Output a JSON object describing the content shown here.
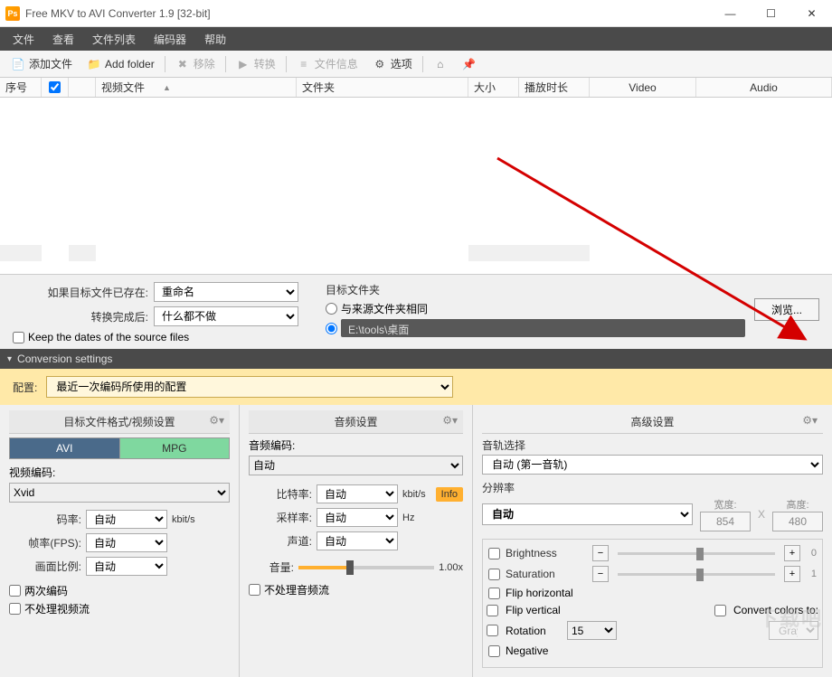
{
  "window": {
    "title": "Free MKV to AVI Converter 1.9  [32-bit]"
  },
  "menu": {
    "file": "文件",
    "view": "查看",
    "filelist": "文件列表",
    "encoder": "编码器",
    "help": "帮助"
  },
  "toolbar": {
    "add_file": "添加文件",
    "add_folder": "Add folder",
    "remove": "移除",
    "convert": "转换",
    "file_info": "文件信息",
    "options": "选项"
  },
  "grid": {
    "seq": "序号",
    "video_file": "视频文件",
    "folder": "文件夹",
    "size": "大小",
    "duration": "播放时长",
    "video": "Video",
    "audio": "Audio"
  },
  "existing": {
    "when_exists_label": "如果目标文件已存在:",
    "when_exists_value": "重命名",
    "after_conv_label": "转换完成后:",
    "after_conv_value": "什么都不做",
    "keep_dates": "Keep the dates of the source files"
  },
  "dest": {
    "label": "目标文件夹",
    "same_as_source": "与来源文件夹相同",
    "path": "E:\\tools\\桌面",
    "browse": "浏览..."
  },
  "conversion": {
    "header": "Conversion settings"
  },
  "config": {
    "label": "配置:",
    "value": "最近一次编码所使用的配置"
  },
  "video_settings": {
    "header": "目标文件格式/视频设置",
    "tab_avi": "AVI",
    "tab_mpg": "MPG",
    "codec_label": "视频编码:",
    "codec_value": "Xvid",
    "bitrate_label": "码率:",
    "bitrate_value": "自动",
    "bitrate_unit": "kbit/s",
    "fps_label": "帧率(FPS):",
    "fps_value": "自动",
    "aspect_label": "画面比例:",
    "aspect_value": "自动",
    "two_pass": "两次编码",
    "skip_video": "不处理视频流"
  },
  "audio_settings": {
    "header": "音频设置",
    "codec_label": "音频编码:",
    "codec_value": "自动",
    "bitrate_label": "比特率:",
    "bitrate_value": "自动",
    "bitrate_unit": "kbit/s",
    "sample_label": "采样率:",
    "sample_value": "自动",
    "sample_unit": "Hz",
    "channel_label": "声道:",
    "channel_value": "自动",
    "volume_label": "音量:",
    "volume_value": "1.00x",
    "info_badge": "Info",
    "skip_audio": "不处理音频流"
  },
  "advanced": {
    "header": "高级设置",
    "track_label": "音轨选择",
    "track_value": "自动 (第一音轨)",
    "res_label": "分辨率",
    "res_value": "自动",
    "width_label": "宽度:",
    "width_value": "854",
    "height_label": "高度:",
    "height_value": "480",
    "brightness": "Brightness",
    "brightness_val": "0",
    "saturation": "Saturation",
    "saturation_val": "1",
    "flip_h": "Flip horizontal",
    "flip_v": "Flip vertical",
    "rotation_label": "Rotation",
    "rotation_value": "15",
    "convert_colors": "Convert colors to:",
    "grayscale": "Grayscale",
    "negative": "Negative"
  },
  "watermark": "下载吧"
}
